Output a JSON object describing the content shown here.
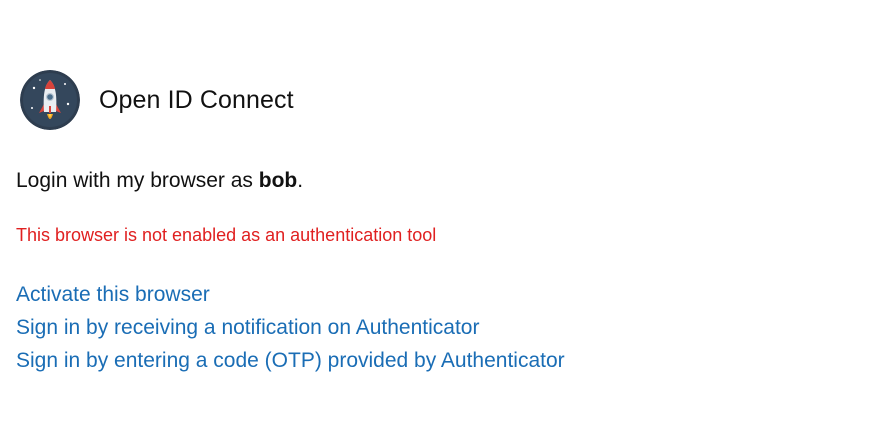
{
  "header": {
    "app_title": "Open ID Connect",
    "logo_icon": "rocket-icon"
  },
  "login": {
    "prefix": "Login with my browser as ",
    "username": "bob",
    "suffix": "."
  },
  "error_message": "This browser is not enabled as an authentication tool",
  "links": [
    {
      "label": "Activate this browser"
    },
    {
      "label": "Sign in by receiving a notification on Authenticator"
    },
    {
      "label": "Sign in by entering a code (OTP) provided by Authenticator"
    }
  ],
  "colors": {
    "link": "#1a6db5",
    "error": "#e02020",
    "text": "#111111",
    "logo_background": "#2e3d4f"
  }
}
